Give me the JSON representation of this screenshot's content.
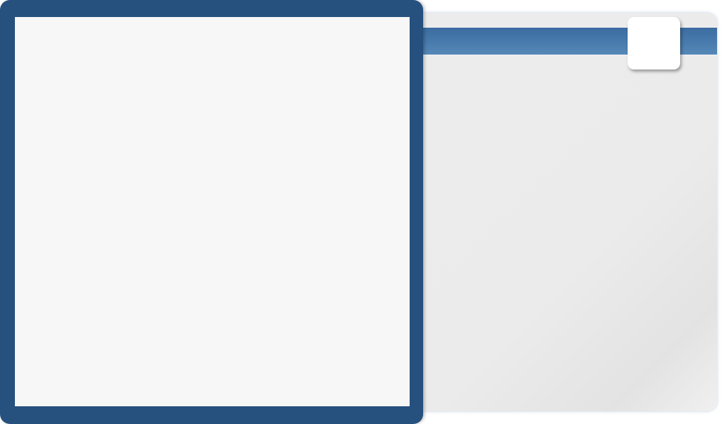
{
  "colors": {
    "frame": "#26507e",
    "band": "#4a7cae",
    "panel": "#f7f7f7",
    "back_panel": "#ebebeb"
  }
}
